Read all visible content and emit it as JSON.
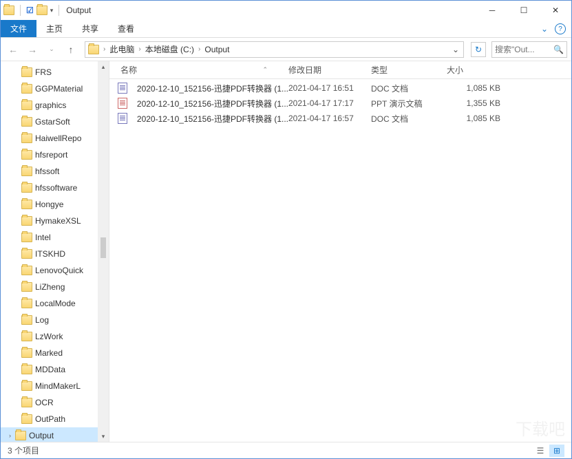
{
  "title": "Output",
  "ribbon": {
    "file": "文件",
    "home": "主页",
    "share": "共享",
    "view": "查看"
  },
  "breadcrumbs": [
    "此电脑",
    "本地磁盘 (C:)",
    "Output"
  ],
  "search_placeholder": "搜索\"Out...",
  "tree_items": [
    "FRS",
    "GGPMaterial",
    "graphics",
    "GstarSoft",
    "HaiwellRepo",
    "hfsreport",
    "hfssoft",
    "hfssoftware",
    "Hongye",
    "HymakeXSL",
    "Intel",
    "ITSKHD",
    "LenovoQuick",
    "LiZheng",
    "LocalMode",
    "Log",
    "LzWork",
    "Marked",
    "MDData",
    "MindMakerL",
    "OCR",
    "OutPath",
    "Output"
  ],
  "selected_tree_index": 22,
  "columns": {
    "name": "名称",
    "date": "修改日期",
    "type": "类型",
    "size": "大小"
  },
  "files": [
    {
      "name": "2020-12-10_152156-迅捷PDF转换器 (1...",
      "date": "2021-04-17 16:51",
      "type": "DOC 文档",
      "size": "1,085 KB",
      "kind": "doc"
    },
    {
      "name": "2020-12-10_152156-迅捷PDF转换器 (1...",
      "date": "2021-04-17 17:17",
      "type": "PPT 演示文稿",
      "size": "1,355 KB",
      "kind": "ppt"
    },
    {
      "name": "2020-12-10_152156-迅捷PDF转换器 (1...",
      "date": "2021-04-17 16:57",
      "type": "DOC 文档",
      "size": "1,085 KB",
      "kind": "doc"
    }
  ],
  "status_text": "3 个项目"
}
